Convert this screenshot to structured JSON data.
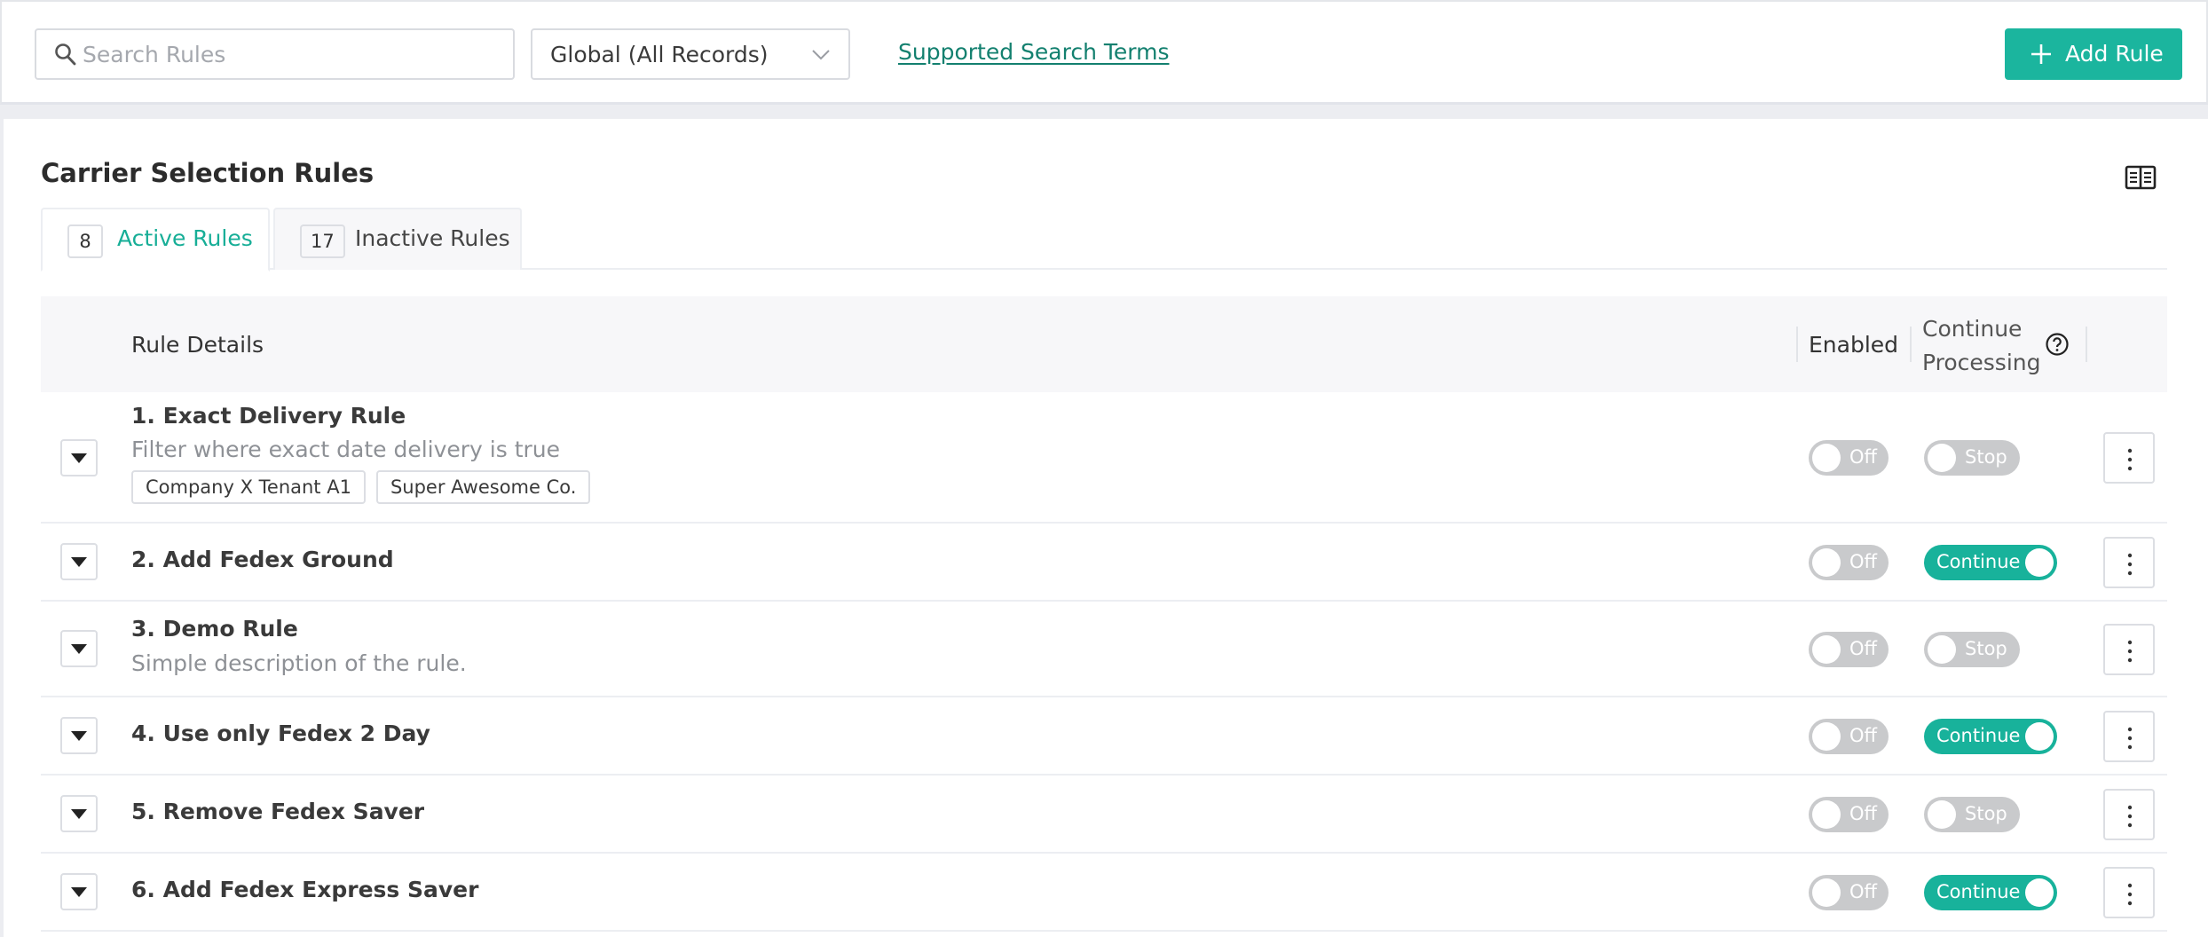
{
  "search": {
    "placeholder": "Search Rules",
    "value": ""
  },
  "scope_select": {
    "selected": "Global (All Records)"
  },
  "help_link": "Supported Search Terms",
  "add_rule_label": "Add Rule",
  "panel": {
    "title": "Carrier Selection Rules",
    "tabs": [
      {
        "count": "8",
        "label": "Active Rules",
        "active": true
      },
      {
        "count": "17",
        "label": "Inactive Rules",
        "active": false
      }
    ]
  },
  "table": {
    "headers": {
      "details": "Rule Details",
      "enabled": "Enabled",
      "continue_line1": "Continue",
      "continue_line2": "Processing"
    },
    "rows": [
      {
        "name": "1. Exact Delivery Rule",
        "description": "Filter where exact date delivery is true",
        "tags": [
          "Company X Tenant A1",
          "Super Awesome Co."
        ],
        "enabled_label": "Off",
        "continue_label": "Stop",
        "continue_on": false
      },
      {
        "name": "2. Add Fedex Ground",
        "description": "",
        "tags": [],
        "enabled_label": "Off",
        "continue_label": "Continue",
        "continue_on": true
      },
      {
        "name": "3. Demo Rule",
        "description": "Simple description of the rule.",
        "tags": [],
        "enabled_label": "Off",
        "continue_label": "Stop",
        "continue_on": false
      },
      {
        "name": "4. Use only Fedex 2 Day",
        "description": "",
        "tags": [],
        "enabled_label": "Off",
        "continue_label": "Continue",
        "continue_on": true
      },
      {
        "name": "5. Remove Fedex Saver",
        "description": "",
        "tags": [],
        "enabled_label": "Off",
        "continue_label": "Stop",
        "continue_on": false
      },
      {
        "name": "6. Add Fedex Express Saver",
        "description": "",
        "tags": [],
        "enabled_label": "Off",
        "continue_label": "Continue",
        "continue_on": true
      }
    ]
  },
  "colors": {
    "accent": "#1bb59e",
    "link": "#13806f",
    "toggle_off": "#c9cacc"
  },
  "icons": {
    "search": "search-icon",
    "chevron": "chevron-down-icon",
    "plus": "plus-icon",
    "columns": "book-icon",
    "help": "help-circle-icon",
    "expand": "caret-down-icon",
    "menu": "more-vertical-icon"
  }
}
